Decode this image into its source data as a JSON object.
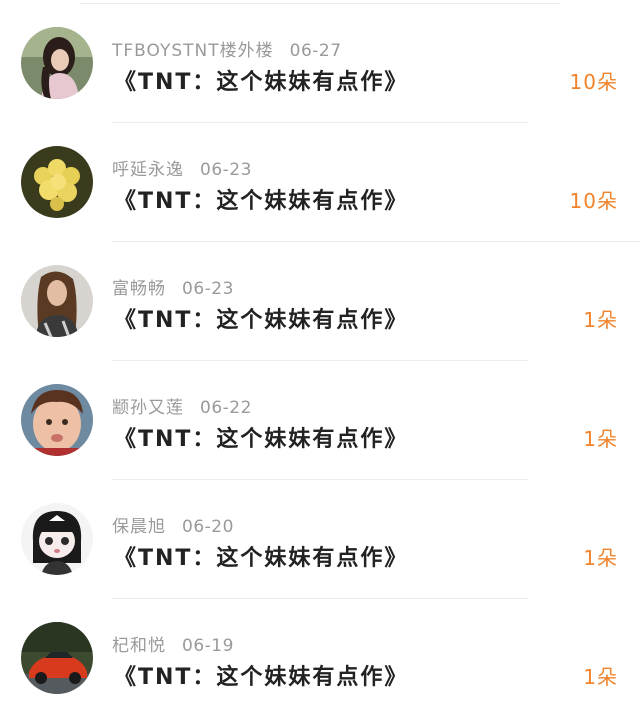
{
  "gifts": [
    {
      "name": "TFBOYSTNT楼外楼",
      "date": "06-27",
      "item": "《TNT：这个妹妹有点作》",
      "count": "10朵",
      "avatar": "avatar-girl-dark-hair"
    },
    {
      "name": "呼延永逸",
      "date": "06-23",
      "item": "《TNT：这个妹妹有点作》",
      "count": "10朵",
      "avatar": "avatar-yellow-flowers"
    },
    {
      "name": "富畅畅",
      "date": "06-23",
      "item": "《TNT：这个妹妹有点作》",
      "count": "1朵",
      "avatar": "avatar-woman-long-hair"
    },
    {
      "name": "颛孙又莲",
      "date": "06-22",
      "item": "《TNT：这个妹妹有点作》",
      "count": "1朵",
      "avatar": "avatar-child"
    },
    {
      "name": "保晨旭",
      "date": "06-20",
      "item": "《TNT：这个妹妹有点作》",
      "count": "1朵",
      "avatar": "avatar-cartoon-girl"
    },
    {
      "name": "杞和悦",
      "date": "06-19",
      "item": "《TNT：这个妹妹有点作》",
      "count": "1朵",
      "avatar": "avatar-red-car"
    }
  ],
  "colors": {
    "count": "#f0832b",
    "meta": "#9a9a9a",
    "title": "#222222",
    "divider": "#ececec"
  }
}
